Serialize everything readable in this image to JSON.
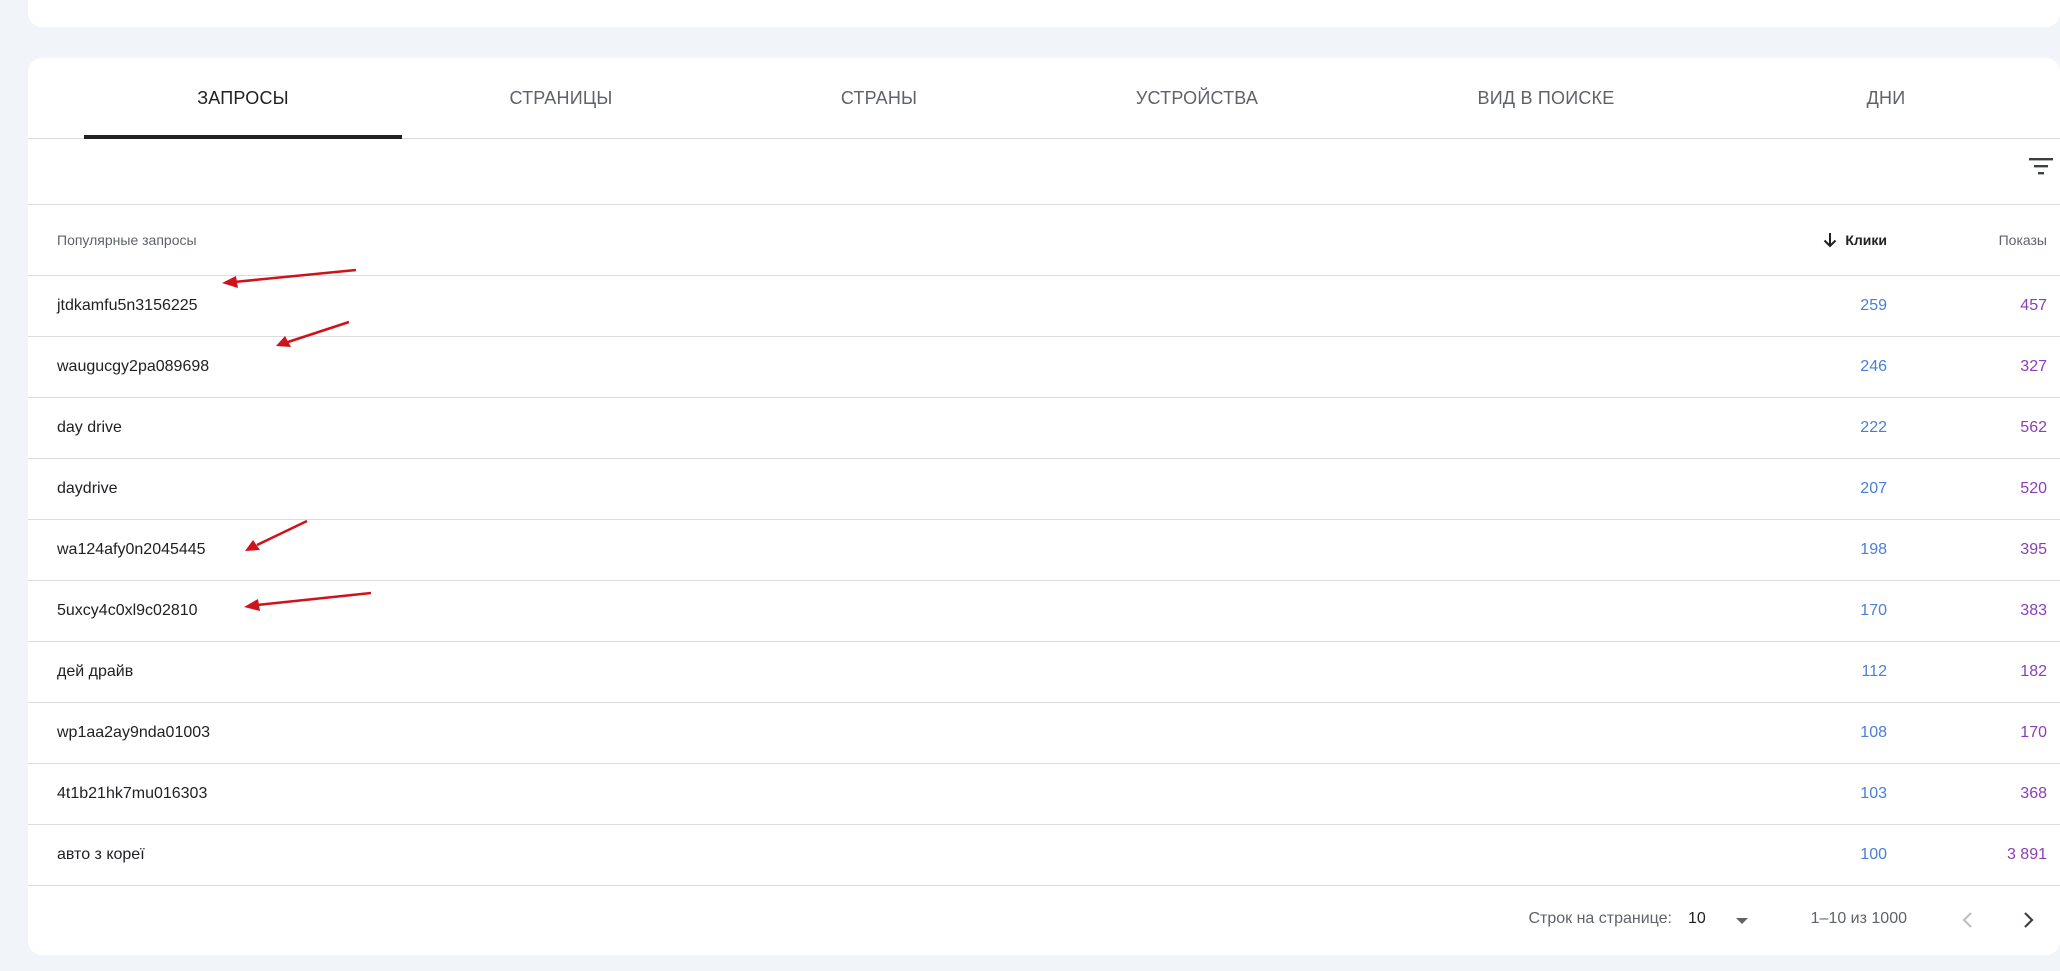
{
  "tabs": [
    {
      "label": "ЗАПРОСЫ",
      "active": true
    },
    {
      "label": "СТРАНИЦЫ",
      "active": false
    },
    {
      "label": "СТРАНЫ",
      "active": false
    },
    {
      "label": "УСТРОЙСТВА",
      "active": false
    },
    {
      "label": "ВИД В ПОИСКЕ",
      "active": false
    },
    {
      "label": "ДНИ",
      "active": false
    }
  ],
  "filter": {
    "icon": "filter-icon"
  },
  "table": {
    "headers": {
      "query": "Популярные запросы",
      "clicks": "Клики",
      "impressions": "Показы"
    },
    "sort_icon": "arrow-down-icon",
    "rows": [
      {
        "query": "jtdkamfu5n3156225",
        "clicks": "259",
        "impressions": "457"
      },
      {
        "query": "waugucgy2pa089698",
        "clicks": "246",
        "impressions": "327"
      },
      {
        "query": "day drive",
        "clicks": "222",
        "impressions": "562"
      },
      {
        "query": "daydrive",
        "clicks": "207",
        "impressions": "520"
      },
      {
        "query": "wa124afy0n2045445",
        "clicks": "198",
        "impressions": "395"
      },
      {
        "query": "5uxcy4c0xl9c02810",
        "clicks": "170",
        "impressions": "383"
      },
      {
        "query": "дей драйв",
        "clicks": "112",
        "impressions": "182"
      },
      {
        "query": "wp1aa2ay9nda01003",
        "clicks": "108",
        "impressions": "170"
      },
      {
        "query": "4t1b21hk7mu016303",
        "clicks": "103",
        "impressions": "368"
      },
      {
        "query": "авто з кореї",
        "clicks": "100",
        "impressions": "3 891"
      }
    ]
  },
  "pagination": {
    "rows_per_page_label": "Строк на странице:",
    "rows_per_page": "10",
    "range": "1–10 из 1000"
  },
  "colors": {
    "clicks": "#4a7fd6",
    "impressions": "#8b3fb6",
    "annotation": "#d0121b"
  }
}
